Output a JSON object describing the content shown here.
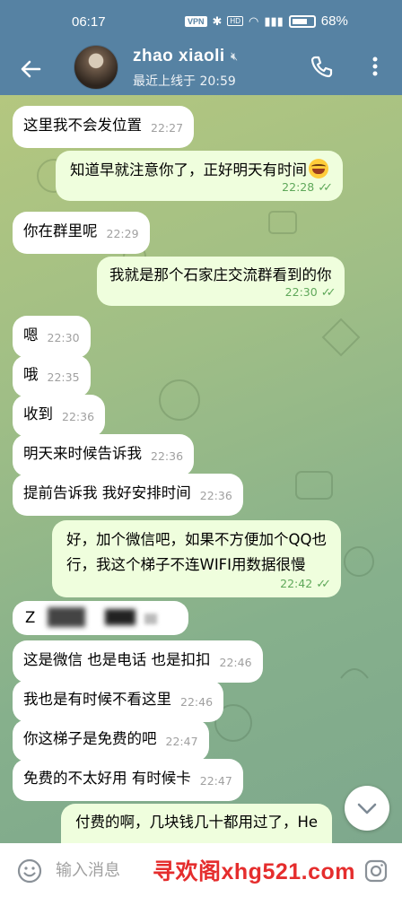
{
  "status_bar": {
    "time": "06:17",
    "vpn": "VPN",
    "hd": "HD",
    "battery": "68%"
  },
  "header": {
    "contact_name": "zhao xiaoli",
    "last_seen": "最近上线于 20:59",
    "avatar_icon": "avatar-photo",
    "icons": [
      "back-arrow-icon",
      "mute-icon",
      "phone-icon",
      "more-vert-icon"
    ]
  },
  "messages": [
    {
      "dir": "in",
      "text": "这里我不会发位置",
      "time": "22:27"
    },
    {
      "dir": "out",
      "text": "知道早就注意你了，正好明天有时间",
      "time": "22:28",
      "emoji": "laughing-tears-emoji"
    },
    {
      "dir": "in",
      "text": "你在群里呢",
      "time": "22:29"
    },
    {
      "dir": "out",
      "text": "我就是那个石家庄交流群看到的你",
      "time": "22:30"
    },
    {
      "dir": "in",
      "text": "嗯",
      "time": "22:30"
    },
    {
      "dir": "in",
      "text": "哦",
      "time": "22:35"
    },
    {
      "dir": "in",
      "text": "收到",
      "time": "22:36"
    },
    {
      "dir": "in",
      "text": "明天来时候告诉我",
      "time": "22:36"
    },
    {
      "dir": "in",
      "text": "提前告诉我 我好安排时间",
      "time": "22:36"
    },
    {
      "dir": "out",
      "text_line1": "好，加个微信吧，如果不方便加个QQ也",
      "text_line2": "行，我这个梯子不连WIFI用数据很慢",
      "time": "22:42"
    },
    {
      "dir": "in",
      "text": "Z",
      "redacted": true
    },
    {
      "dir": "in",
      "text": "这是微信  也是电话 也是扣扣",
      "time": "22:46"
    },
    {
      "dir": "in",
      "text": "我也是有时候不看这里",
      "time": "22:46"
    },
    {
      "dir": "in",
      "text": "你这梯子是免费的吧",
      "time": "22:47"
    },
    {
      "dir": "in",
      "text": "免费的不太好用  有时候卡",
      "time": "22:47"
    },
    {
      "dir": "out",
      "text_line1": "付费的啊，几块钱几十都用过了，He",
      "partial": true
    }
  ],
  "input": {
    "placeholder": "输入消息",
    "icons": [
      "emoji-smile-icon",
      "camera-icon",
      "chevron-down-icon"
    ]
  },
  "watermark": "寻欢阁xhg521.com",
  "colors": {
    "header": "#5682a3",
    "bubble_in": "#ffffff",
    "bubble_out": "#effedd",
    "read_tick": "#5fa85a",
    "watermark": "#e52d2d"
  }
}
